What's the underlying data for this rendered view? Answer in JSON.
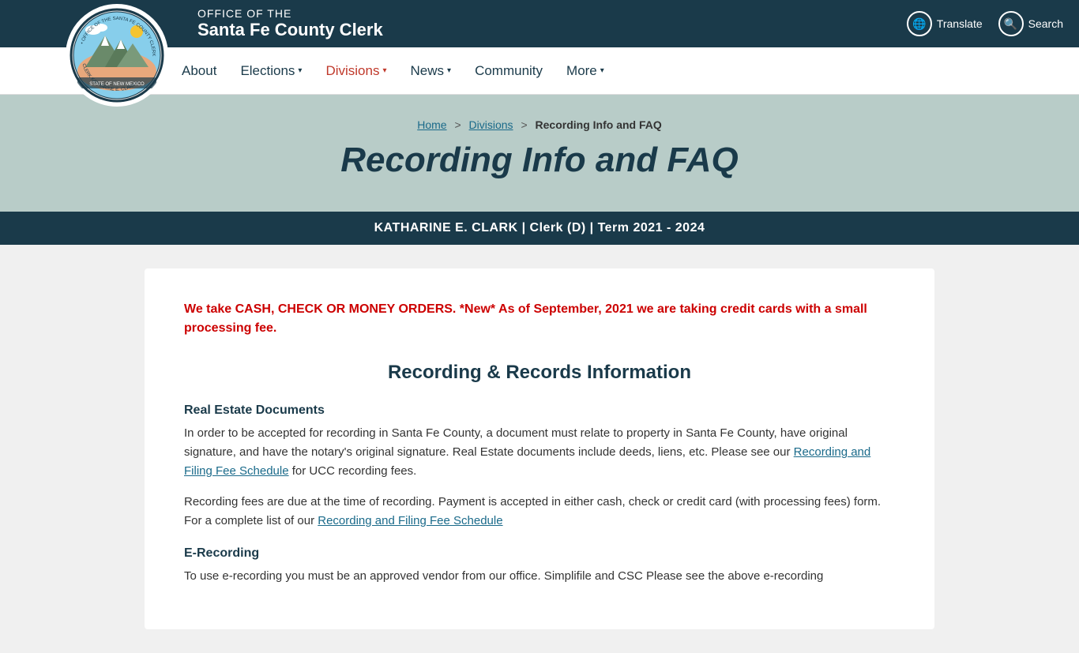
{
  "header": {
    "office_line1": "OFFICE OF THE",
    "office_line2": "Santa Fe County Clerk",
    "translate_label": "Translate",
    "search_label": "Search"
  },
  "nav": {
    "items": [
      {
        "id": "about",
        "label": "About",
        "has_dropdown": false
      },
      {
        "id": "elections",
        "label": "Elections",
        "has_dropdown": true
      },
      {
        "id": "divisions",
        "label": "Divisions",
        "has_dropdown": true,
        "active": true
      },
      {
        "id": "news",
        "label": "News",
        "has_dropdown": true
      },
      {
        "id": "community",
        "label": "Community",
        "has_dropdown": false
      },
      {
        "id": "more",
        "label": "More",
        "has_dropdown": true
      }
    ]
  },
  "breadcrumb": {
    "home": "Home",
    "divisions": "Divisions",
    "current": "Recording Info and FAQ"
  },
  "page_title": "Recording Info and FAQ",
  "clerk_bar": "KATHARINE E. CLARK | Clerk (D) | Term 2021 - 2024",
  "content": {
    "notice": "We take CASH, CHECK OR MONEY ORDERS. *New* As of September, 2021 we are taking credit cards with a small processing fee.",
    "section_title": "Recording & Records Information",
    "subsection1_title": "Real Estate Documents",
    "subsection1_text1": "In order to be accepted for recording in Santa Fe County, a document must relate to property in Santa Fe County, have original signature, and have the notary's original signature. Real Estate documents include deeds, liens, etc. Please see our",
    "subsection1_link1": "Recording and Filing Fee Schedule",
    "subsection1_text1b": "for UCC recording fees.",
    "subsection1_text2": "Recording fees are due at the time of recording. Payment is accepted in either cash, check or credit card (with processing fees) form. For a complete list of our",
    "subsection1_link2": "Recording and Filing Fee Schedule",
    "subsection2_title": "E-Recording",
    "subsection2_text": "To use e-recording you must be an approved vendor from our office. Simplifile and CSC Please see the above e-recording"
  },
  "colors": {
    "dark_navy": "#1a3a4a",
    "red_accent": "#c0392b",
    "banner_bg": "#b8ccc8",
    "notice_red": "#cc0000",
    "link_blue": "#1a6a8a"
  }
}
